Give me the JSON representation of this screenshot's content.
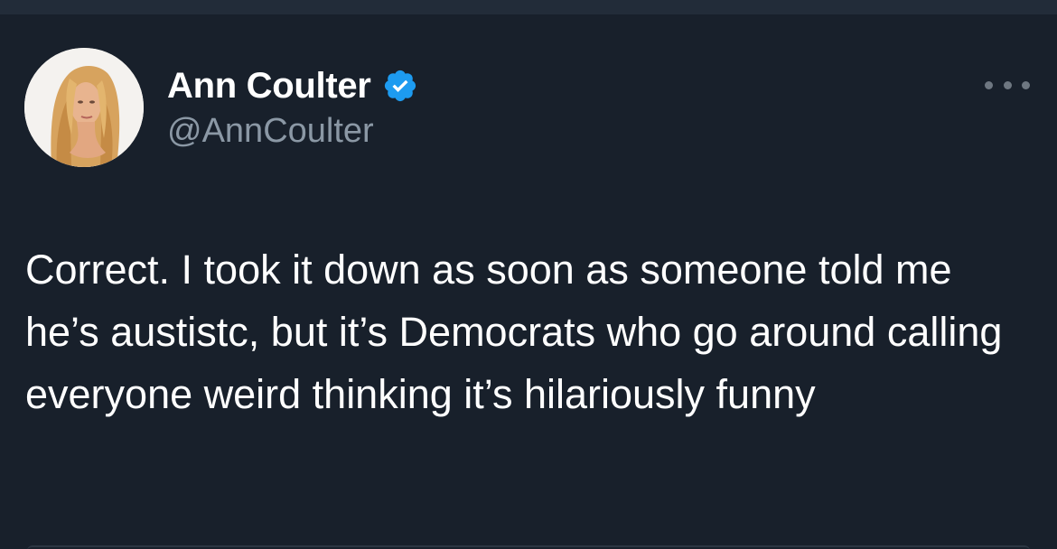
{
  "tweet": {
    "author": {
      "display_name": "Ann Coulter",
      "handle": "@AnnCoulter",
      "verified": true,
      "avatar_icon": "profile-photo-icon"
    },
    "text": "Correct. I took it down as soon as someone told me he’s austistc, but it’s Democrats who go around calling everyone weird thinking it’s hilariously funny",
    "more_icon": "more-options-icon"
  },
  "colors": {
    "background": "#18202b",
    "text_primary": "#ffffff",
    "text_secondary": "#8b98a5",
    "verified_badge": "#1d9bf0"
  }
}
